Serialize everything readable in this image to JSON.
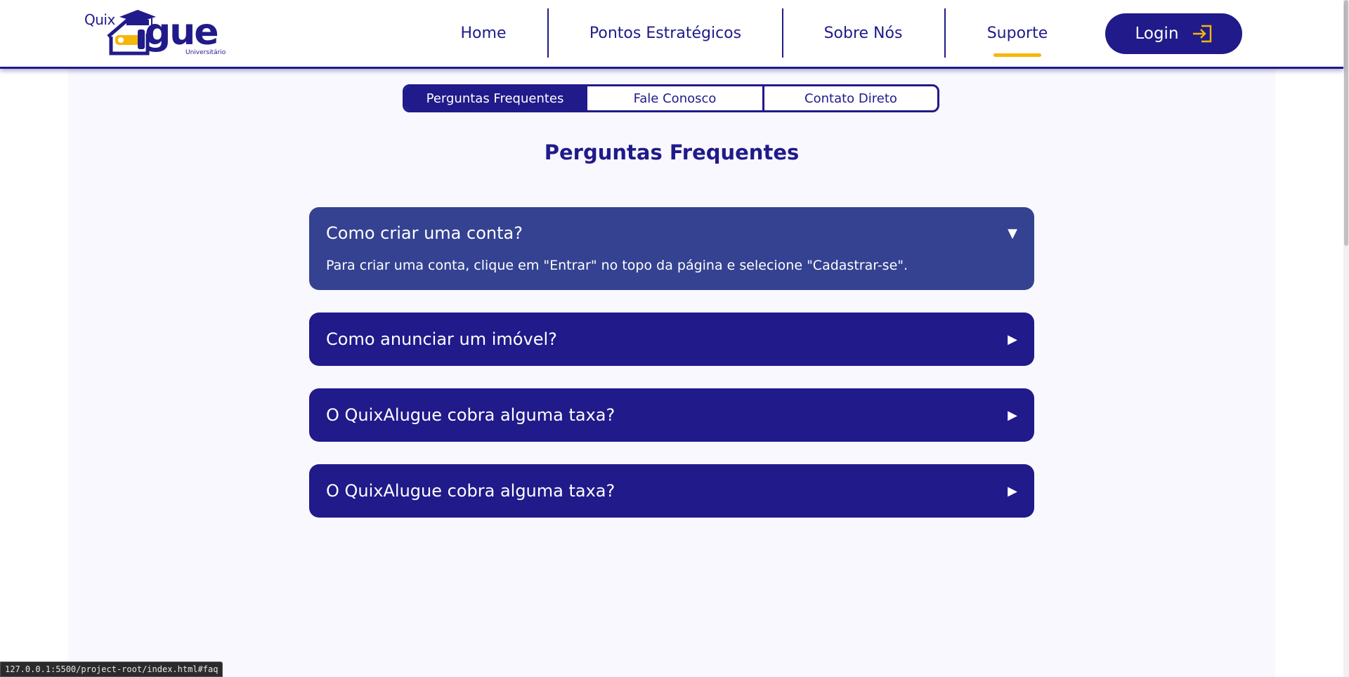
{
  "header": {
    "logo": {
      "quix": "Quix",
      "wordmark": "gue",
      "tagline": "Universitário"
    },
    "nav": [
      {
        "label": "Home"
      },
      {
        "label": "Pontos Estratégicos"
      },
      {
        "label": "Sobre Nós"
      },
      {
        "label": "Suporte",
        "active": true
      }
    ],
    "login_label": "Login"
  },
  "tabs": [
    {
      "label": "Perguntas Frequentes",
      "active": true
    },
    {
      "label": "Fale Conosco"
    },
    {
      "label": "Contato Direto"
    }
  ],
  "page_title": "Perguntas Frequentes",
  "faq": [
    {
      "question": "Como criar uma conta?",
      "answer": "Para criar uma conta, clique em \"Entrar\" no topo da página e selecione \"Cadastrar-se\".",
      "expanded": true,
      "arrow": "▼"
    },
    {
      "question": "Como anunciar um imóvel?",
      "expanded": false,
      "arrow": "▶"
    },
    {
      "question": "O QuixAlugue cobra alguma taxa?",
      "expanded": false,
      "arrow": "▶"
    },
    {
      "question": "O QuixAlugue cobra alguma taxa?",
      "expanded": false,
      "arrow": "▶"
    }
  ],
  "status_url": "127.0.0.1:5500/project-root/index.html#faq",
  "colors": {
    "primary": "#201a8a",
    "accent": "#f5b70a",
    "faq_open": "#344291",
    "background": "#f8f8fe"
  }
}
